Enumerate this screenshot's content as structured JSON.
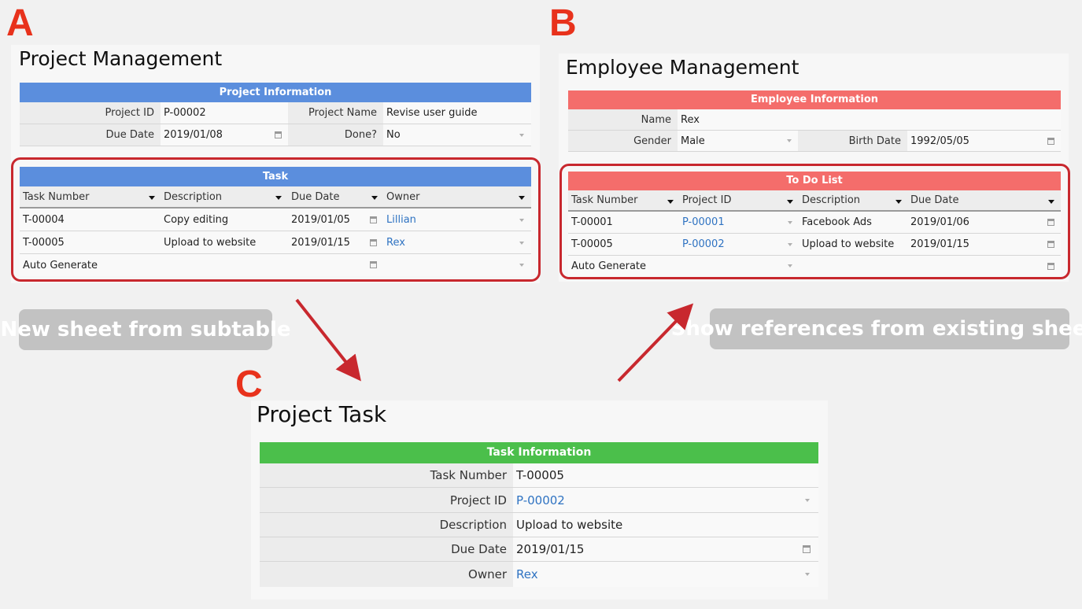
{
  "labels": {
    "a": "A",
    "b": "B",
    "c": "C"
  },
  "callouts": {
    "left": "New sheet from subtable",
    "right": "Show references from existing sheets"
  },
  "colors": {
    "blue": "#5b8edd",
    "red": "#f46d6b",
    "green": "#4bbf4b",
    "highlight": "#c8282e",
    "label_letters": "#e8321c"
  },
  "sheet_a": {
    "title": "Project Management",
    "info_header": "Project Information",
    "project_id_label": "Project ID",
    "project_id": "P-00002",
    "project_name_label": "Project Name",
    "project_name": "Revise user guide",
    "due_date_label": "Due Date",
    "due_date": "2019/01/08",
    "done_label": "Done?",
    "done": "No",
    "task_header": "Task",
    "columns": [
      "Task Number",
      "Description",
      "Due Date",
      "Owner"
    ],
    "rows": [
      {
        "task_number": "T-00004",
        "description": "Copy editing",
        "due_date": "2019/01/05",
        "owner": "Lillian"
      },
      {
        "task_number": "T-00005",
        "description": "Upload to website",
        "due_date": "2019/01/15",
        "owner": "Rex"
      }
    ],
    "new_row": "Auto Generate"
  },
  "sheet_b": {
    "title": "Employee Management",
    "info_header": "Employee Information",
    "name_label": "Name",
    "name": "Rex",
    "gender_label": "Gender",
    "gender": "Male",
    "birth_label": "Birth Date",
    "birth_date": "1992/05/05",
    "todo_header": "To Do List",
    "columns": [
      "Task Number",
      "Project ID",
      "Description",
      "Due Date"
    ],
    "rows": [
      {
        "task_number": "T-00001",
        "project_id": "P-00001",
        "description": "Facebook Ads",
        "due_date": "2019/01/06"
      },
      {
        "task_number": "T-00005",
        "project_id": "P-00002",
        "description": "Upload to website",
        "due_date": "2019/01/15"
      }
    ],
    "new_row": "Auto Generate"
  },
  "sheet_c": {
    "title": "Project Task",
    "info_header": "Task Information",
    "fields": [
      {
        "label": "Task Number",
        "value": "T-00005"
      },
      {
        "label": "Project ID",
        "value": "P-00002"
      },
      {
        "label": "Description",
        "value": "Upload to website"
      },
      {
        "label": "Due Date",
        "value": "2019/01/15"
      },
      {
        "label": "Owner",
        "value": "Rex"
      }
    ]
  },
  "icons": {
    "dropdown": "triangle-down",
    "date_picker": "calendar"
  }
}
